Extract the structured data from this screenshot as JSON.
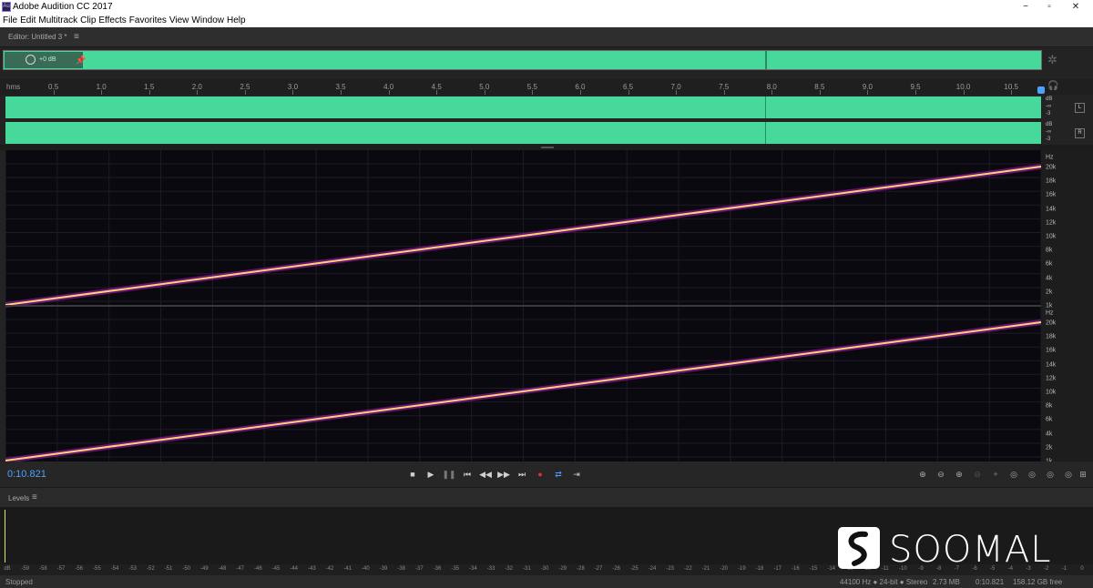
{
  "window": {
    "app_icon": "Au",
    "title": "Adobe Audition CC 2017",
    "controls": [
      "−",
      "▫",
      "✕"
    ]
  },
  "menu": [
    "File",
    "Edit",
    "Multitrack",
    "Clip",
    "Effects",
    "Favorites",
    "View",
    "Window",
    "Help"
  ],
  "editor": {
    "label": "Editor: Untitled 3 *",
    "menu_icon": "menu-icon"
  },
  "overview": {
    "volume": "+0 dB",
    "waveform_color": "#47d99b"
  },
  "ruler": {
    "unit": "hms",
    "ticks": [
      "0.5",
      "1.0",
      "1.5",
      "2.0",
      "2.5",
      "3.0",
      "3.5",
      "4.0",
      "4.5",
      "5.0",
      "5.5",
      "6.0",
      "6.5",
      "7.0",
      "7.5",
      "8.0",
      "8.5",
      "9.0",
      "9.5",
      "10.0",
      "10.5"
    ]
  },
  "channels": [
    {
      "db_unit": "dB",
      "db_inf": "-∞",
      "db_low": "-3",
      "button": "L"
    },
    {
      "db_unit": "dB",
      "db_inf": "-∞",
      "db_low": "-3",
      "button": "R"
    }
  ],
  "spectral": {
    "unit": "Hz",
    "labels": [
      "20k",
      "18k",
      "16k",
      "14k",
      "12k",
      "10k",
      "8k",
      "6k",
      "4k",
      "2k",
      "1k"
    ],
    "sweep_start_hz": 1000,
    "sweep_end_hz": 20000,
    "line_color": "#ffd27a",
    "glow_color": "#b020c0"
  },
  "transport": {
    "time": "0:10.821",
    "buttons": [
      "■",
      "▶",
      "❚❚",
      "⏮",
      "◀◀",
      "▶▶",
      "⏭",
      "●",
      "⇄",
      "⇥"
    ],
    "zoom_buttons": [
      "⊕",
      "⊖",
      "⊕",
      "⊖",
      "✦",
      "◎",
      "◎",
      "◎",
      "◎",
      "⊞"
    ]
  },
  "levels": {
    "label": "Levels",
    "scale": [
      "dB",
      "-59",
      "-58",
      "-57",
      "-56",
      "-55",
      "-54",
      "-53",
      "-52",
      "-51",
      "-50",
      "-49",
      "-48",
      "-47",
      "-46",
      "-45",
      "-44",
      "-43",
      "-42",
      "-41",
      "-40",
      "-39",
      "-38",
      "-37",
      "-36",
      "-35",
      "-34",
      "-33",
      "-32",
      "-31",
      "-30",
      "-29",
      "-28",
      "-27",
      "-26",
      "-25",
      "-24",
      "-23",
      "-22",
      "-21",
      "-20",
      "-19",
      "-18",
      "-17",
      "-16",
      "-15",
      "-14",
      "-13",
      "-12",
      "-11",
      "-10",
      "-9",
      "-8",
      "-7",
      "-6",
      "-5",
      "-4",
      "-3",
      "-2",
      "-1",
      "0"
    ]
  },
  "status": {
    "state": "Stopped",
    "format": "44100 Hz ● 24-bit ● Stereo",
    "size": "2.73 MB",
    "duration": "0:10.821",
    "free": "158.12 GB free"
  },
  "watermark": {
    "text": "SOOMAL"
  }
}
